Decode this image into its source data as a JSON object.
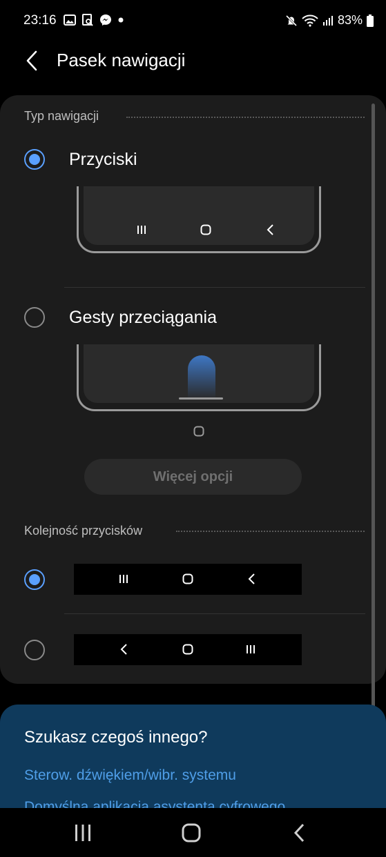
{
  "status_bar": {
    "time": "23:16",
    "battery": "83%",
    "left_icons": [
      "gallery-icon",
      "scan-icon",
      "messenger-icon",
      "dot-icon"
    ],
    "right_icons": [
      "mute-icon",
      "wifi-icon",
      "signal-icon",
      "battery-icon"
    ]
  },
  "header": {
    "title": "Pasek nawigacji"
  },
  "navigation_type": {
    "section_title": "Typ nawigacji",
    "options": [
      {
        "label": "Przyciski",
        "selected": true
      },
      {
        "label": "Gesty przeciągania",
        "selected": false
      }
    ],
    "more_options_label": "Więcej opcji"
  },
  "button_order": {
    "section_title": "Kolejność przycisków",
    "options": [
      {
        "order": [
          "recent-apps-icon",
          "home-icon",
          "back-icon"
        ],
        "selected": true
      },
      {
        "order": [
          "back-icon",
          "home-icon",
          "recent-apps-icon"
        ],
        "selected": false
      }
    ]
  },
  "suggestions": {
    "title": "Szukasz czegoś innego?",
    "links": [
      "Sterow. dźwiękiem/wibr. systemu",
      "Domyślna aplikacja asystenta cyfrowego"
    ]
  },
  "colors": {
    "accent": "#5aa0ff",
    "card_bg": "#1c1c1c",
    "suggest_bg": "#0f3a5c",
    "link": "#4f9ee8"
  }
}
